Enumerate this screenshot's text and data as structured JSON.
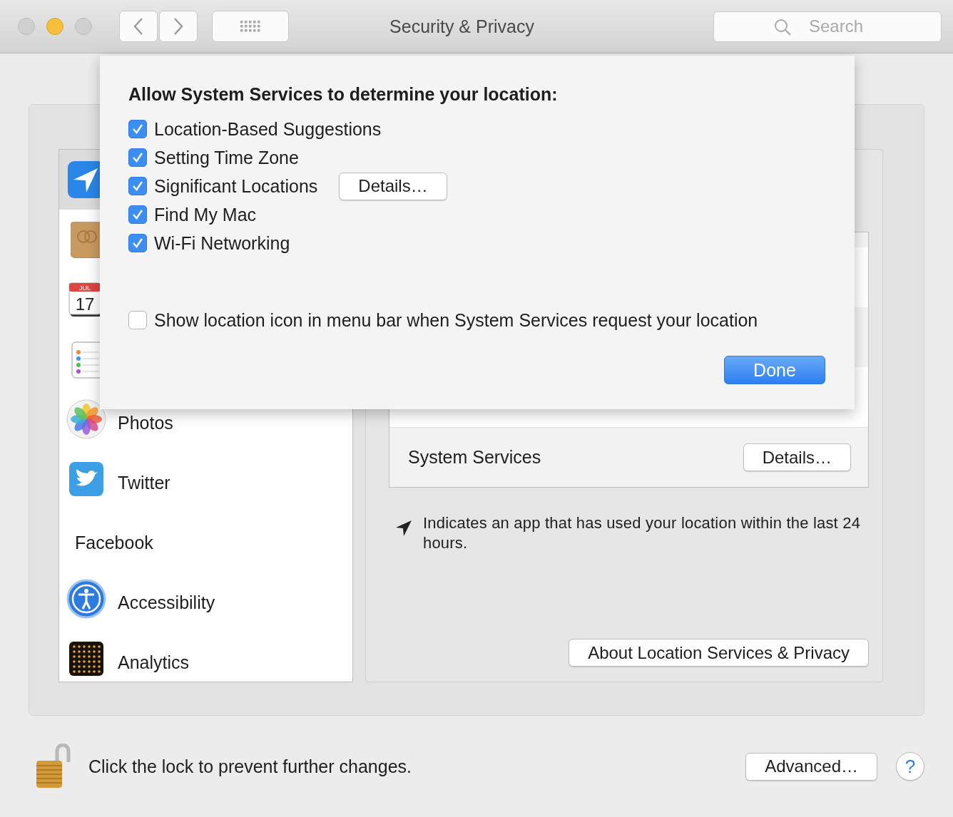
{
  "window": {
    "title": "Security & Privacy"
  },
  "toolbar": {
    "search": {
      "placeholder": "Search"
    }
  },
  "sidebar": {
    "items": [
      {
        "selected": true
      },
      {
        "selected": false
      },
      {
        "selected": false,
        "icon_text": {
          "month": "JUL",
          "day": "17"
        }
      },
      {
        "selected": false
      },
      {
        "label": "Photos",
        "selected": false
      },
      {
        "label": "Twitter",
        "selected": false
      },
      {
        "label": "Facebook",
        "selected": false
      },
      {
        "label": "Accessibility",
        "selected": false
      },
      {
        "label": "Analytics",
        "selected": false
      }
    ]
  },
  "location_panel": {
    "system_services": {
      "label": "System Services",
      "button": "Details…"
    },
    "legend": "Indicates an app that has used your location within the last 24 hours.",
    "about_button": "About Location Services & Privacy"
  },
  "footer": {
    "lock_text": "Click the lock to prevent further changes.",
    "advanced_button": "Advanced…",
    "help_button": "?"
  },
  "sheet": {
    "heading": "Allow System Services to determine your location:",
    "options": [
      {
        "label": "Location-Based Suggestions",
        "checked": true
      },
      {
        "label": "Setting Time Zone",
        "checked": true
      },
      {
        "label": "Significant Locations",
        "checked": true,
        "button": "Details…"
      },
      {
        "label": "Find My Mac",
        "checked": true
      },
      {
        "label": "Wi-Fi Networking",
        "checked": true
      }
    ],
    "menu_bar_option": {
      "label": "Show location icon in menu bar when System Services request your location",
      "checked": false
    },
    "done_button": "Done"
  }
}
